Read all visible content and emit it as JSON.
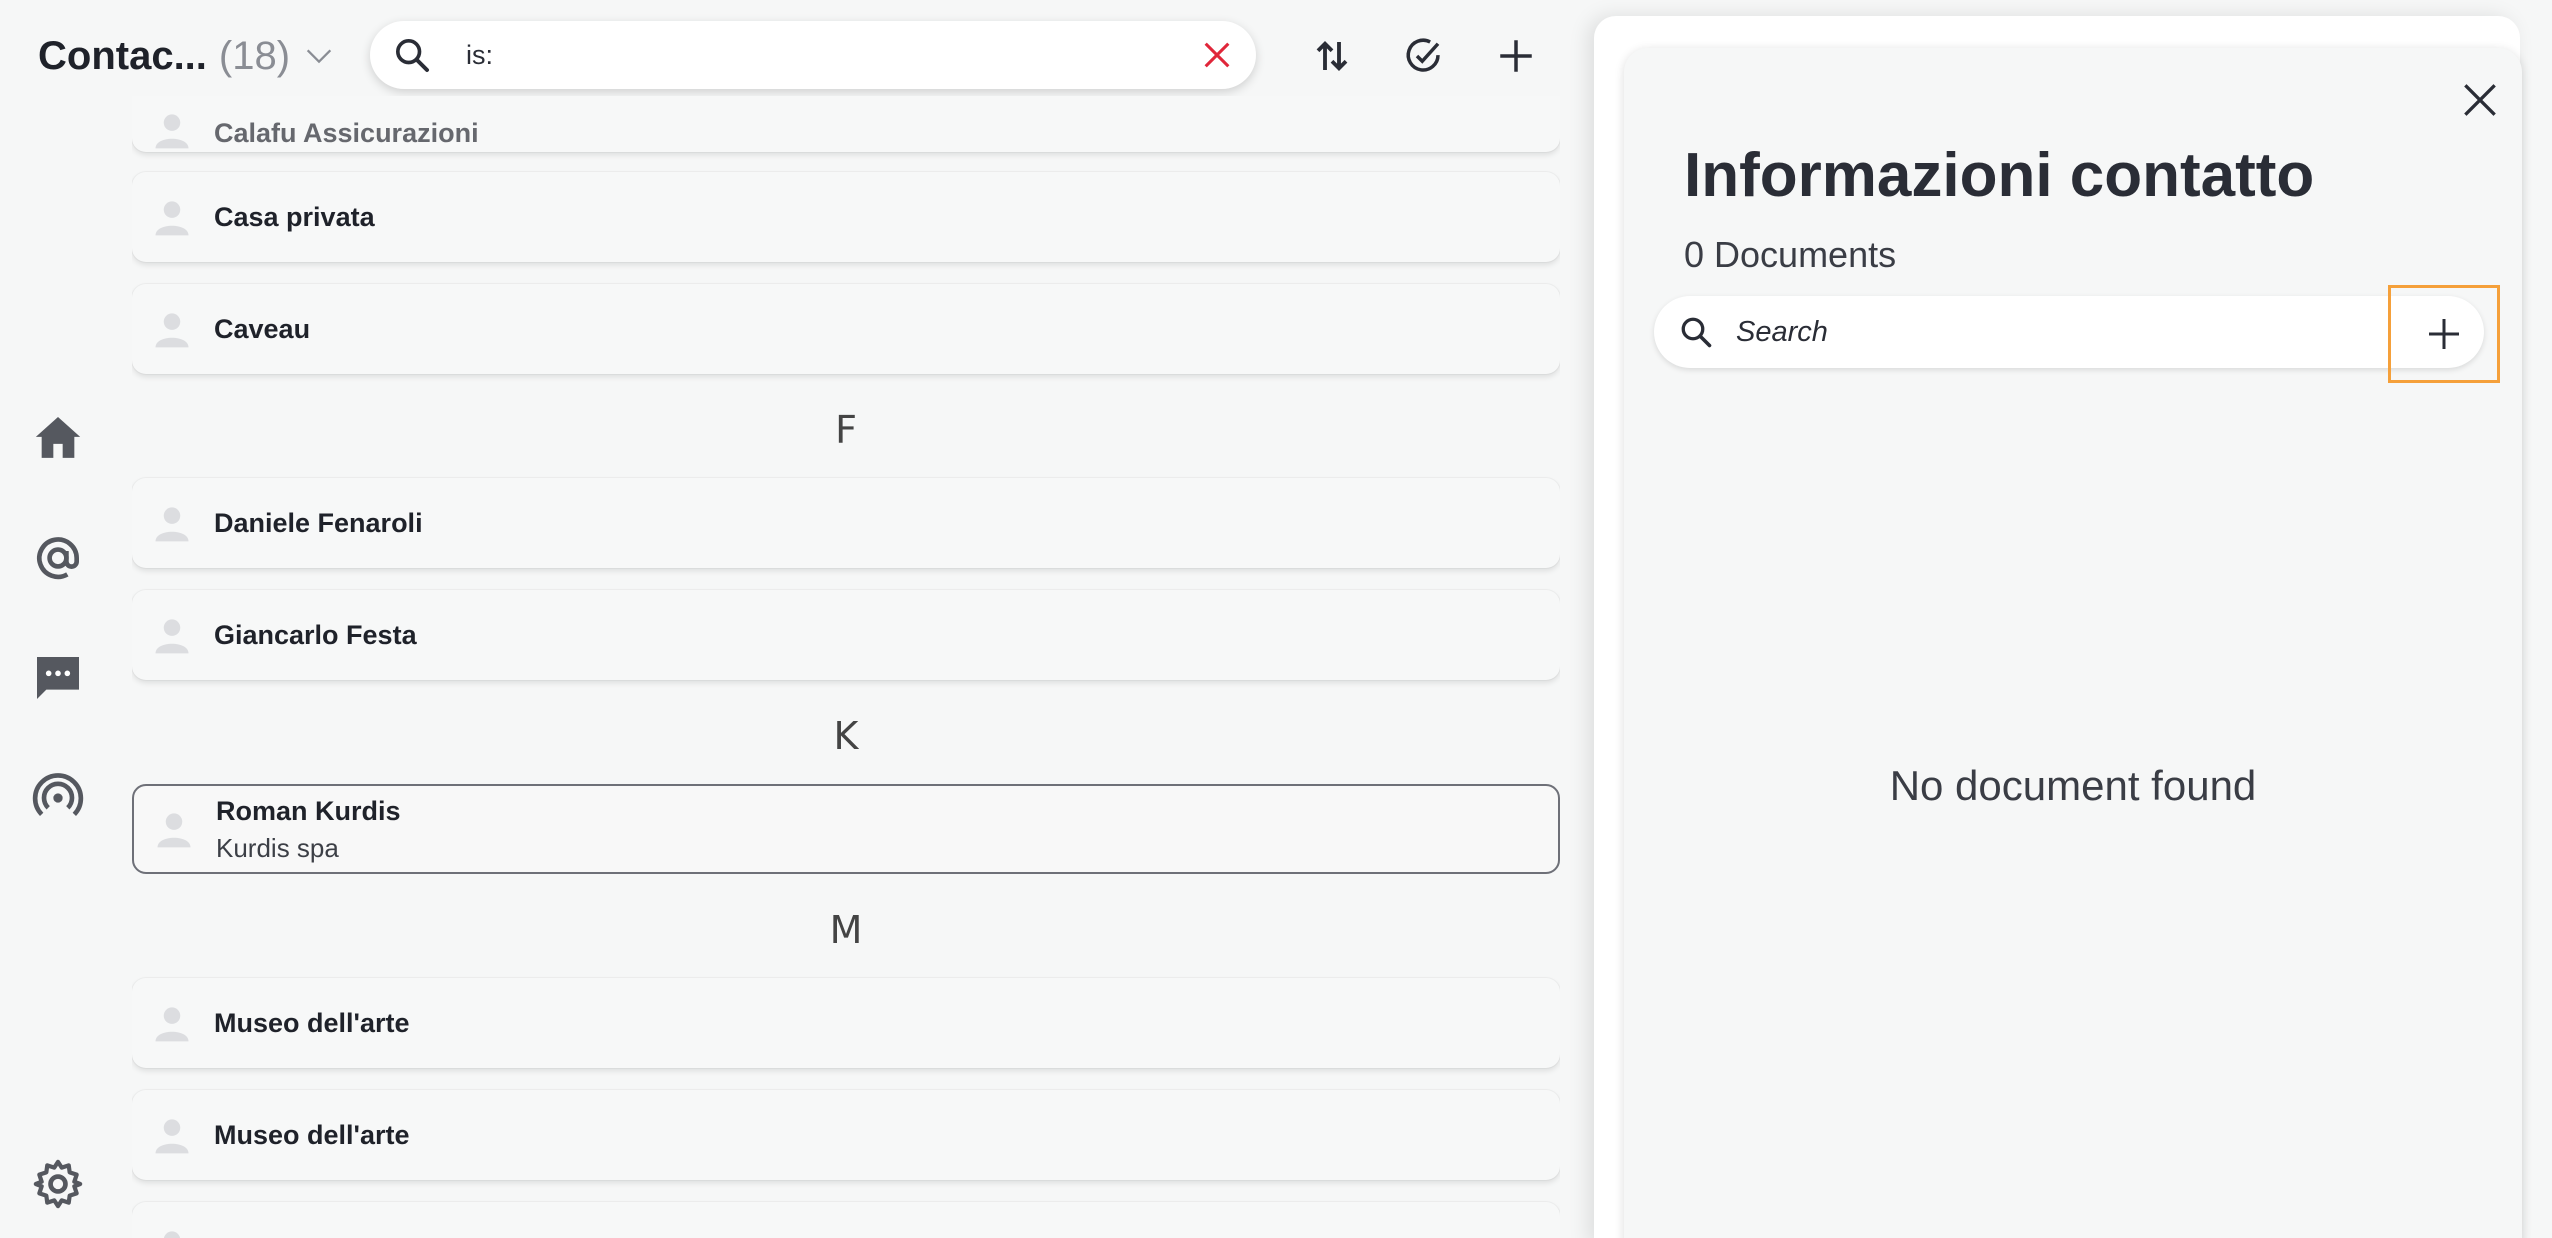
{
  "header": {
    "title": "Contac...",
    "count": "(18)",
    "search_value": "is:"
  },
  "contacts": {
    "items": [
      {
        "name": "Calafu Assicurazioni",
        "subtitle": ""
      },
      {
        "name": "Casa privata",
        "subtitle": ""
      },
      {
        "name": "Caveau",
        "subtitle": ""
      },
      {
        "name": "Daniele Fenaroli",
        "subtitle": ""
      },
      {
        "name": "Giancarlo Festa",
        "subtitle": ""
      },
      {
        "name": "Roman Kurdis",
        "subtitle": "Kurdis spa"
      },
      {
        "name": "Museo dell'arte",
        "subtitle": ""
      },
      {
        "name": "Museo dell'arte",
        "subtitle": ""
      }
    ],
    "sections": [
      "F",
      "K",
      "M"
    ]
  },
  "panel": {
    "title": "Informazioni contatto",
    "doc_count": "0 Documents",
    "search_placeholder": "Search",
    "empty_text": "No document found"
  },
  "icons": {
    "header": [
      "search-icon",
      "clear-icon",
      "sort-icon",
      "select-icon",
      "add-icon"
    ],
    "rail": [
      "home-icon",
      "email-icon",
      "chat-icon",
      "broadcast-icon",
      "settings-icon"
    ],
    "panel": [
      "close-icon",
      "search-icon",
      "add-icon"
    ]
  },
  "colors": {
    "accent_highlight": "#f5a03a",
    "clear_icon": "#e0263a",
    "text_primary": "#2a2d36"
  }
}
